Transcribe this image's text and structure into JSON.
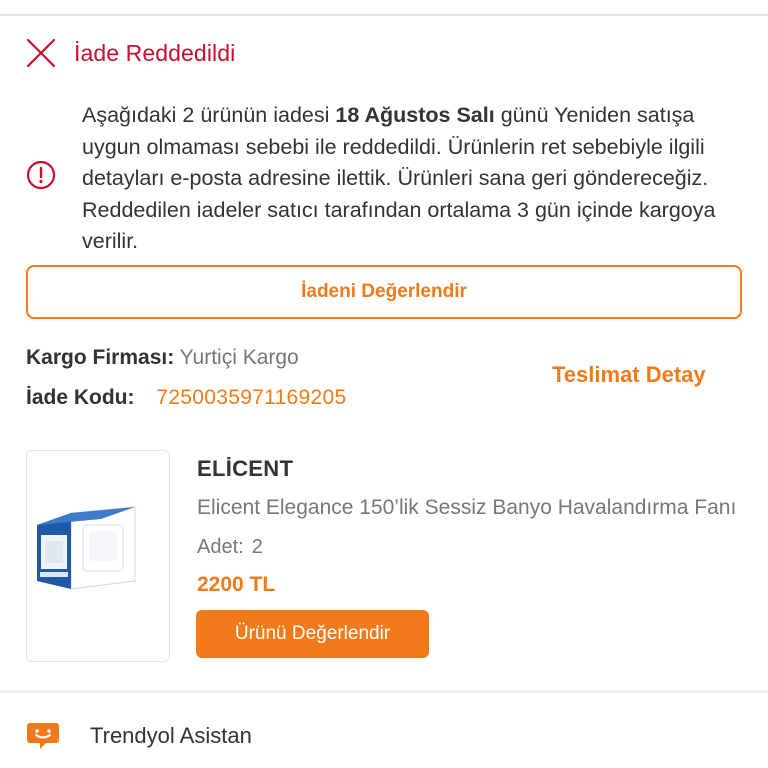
{
  "status": {
    "title": "İade Reddedildi",
    "icon": "close-icon",
    "color": "#c8102e"
  },
  "info": {
    "icon": "info-icon",
    "text_part1": "Aşağıdaki 2 ürünün iadesi ",
    "date_bold": "18 Ağustos Salı",
    "text_part2": " günü Yeniden satışa uygun olmaması sebebi ile reddedildi. Ürünlerin ret sebebiyle ilgili detayları e-posta adresine ilettik. Ürünleri sana geri göndereceğiz. Reddedilen iadeler satıcı tarafından ortalama 3 gün içinde kargoya verilir."
  },
  "actions": {
    "review_return_label": "İadeni Değerlendir",
    "delivery_detail_label": "Teslimat Detay"
  },
  "shipping": {
    "cargo_label": "Kargo Firması:",
    "cargo_value": "Yurtiçi Kargo",
    "code_label": "İade Kodu:",
    "code_value": "7250035971169205"
  },
  "product": {
    "brand": "ELİCENT",
    "name": "Elicent Elegance 150’lik Sessiz Banyo Havalandırma Fanı",
    "qty_label": "Adet:",
    "qty_value": "2",
    "price": "2200 TL",
    "review_label": "Ürünü Değerlendir",
    "image_icon": "product-box-image"
  },
  "assistant": {
    "label": "Trendyol Asistan",
    "icon": "chat-bubble-icon"
  },
  "colors": {
    "accent": "#f27a1a",
    "danger": "#c8102e",
    "text": "#333333",
    "muted": "#777777"
  }
}
